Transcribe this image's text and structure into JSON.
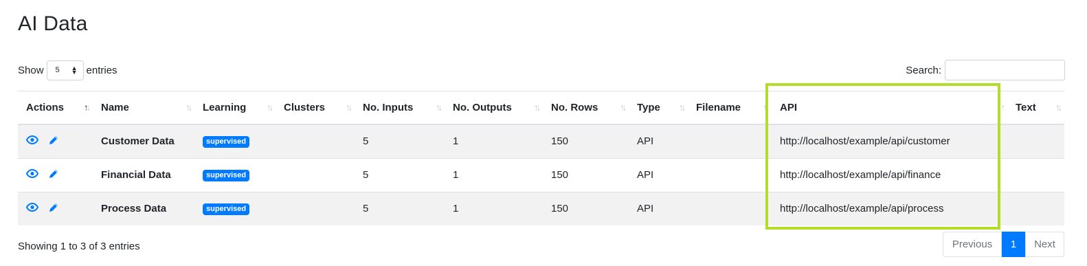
{
  "page": {
    "title": "AI Data"
  },
  "length": {
    "show_label": "Show",
    "selected": "5",
    "entries_label": "entries"
  },
  "search": {
    "label": "Search:",
    "value": "",
    "placeholder": ""
  },
  "table": {
    "columns": [
      "Actions",
      "Name",
      "Learning",
      "Clusters",
      "No. Inputs",
      "No. Outputs",
      "No. Rows",
      "Type",
      "Filename",
      "API",
      "Text"
    ],
    "sorted_column": "Actions",
    "rows": [
      {
        "name": "Customer Data",
        "learning": "supervised",
        "clusters": "",
        "inputs": "5",
        "outputs": "1",
        "rows": "150",
        "type": "API",
        "filename": "",
        "api": "http://localhost/example/api/customer",
        "text": ""
      },
      {
        "name": "Financial Data",
        "learning": "supervised",
        "clusters": "",
        "inputs": "5",
        "outputs": "1",
        "rows": "150",
        "type": "API",
        "filename": "",
        "api": "http://localhost/example/api/finance",
        "text": ""
      },
      {
        "name": "Process Data",
        "learning": "supervised",
        "clusters": "",
        "inputs": "5",
        "outputs": "1",
        "rows": "150",
        "type": "API",
        "filename": "",
        "api": "http://localhost/example/api/process",
        "text": ""
      }
    ],
    "row_icons": [
      "eye-icon",
      "pencil-icon"
    ]
  },
  "info": {
    "text": "Showing 1 to 3 of 3 entries"
  },
  "pagination": {
    "previous": "Previous",
    "current": "1",
    "next": "Next"
  },
  "colors": {
    "accent": "#007bff",
    "highlight": "#b2dd28",
    "stripe": "#f2f2f2"
  }
}
